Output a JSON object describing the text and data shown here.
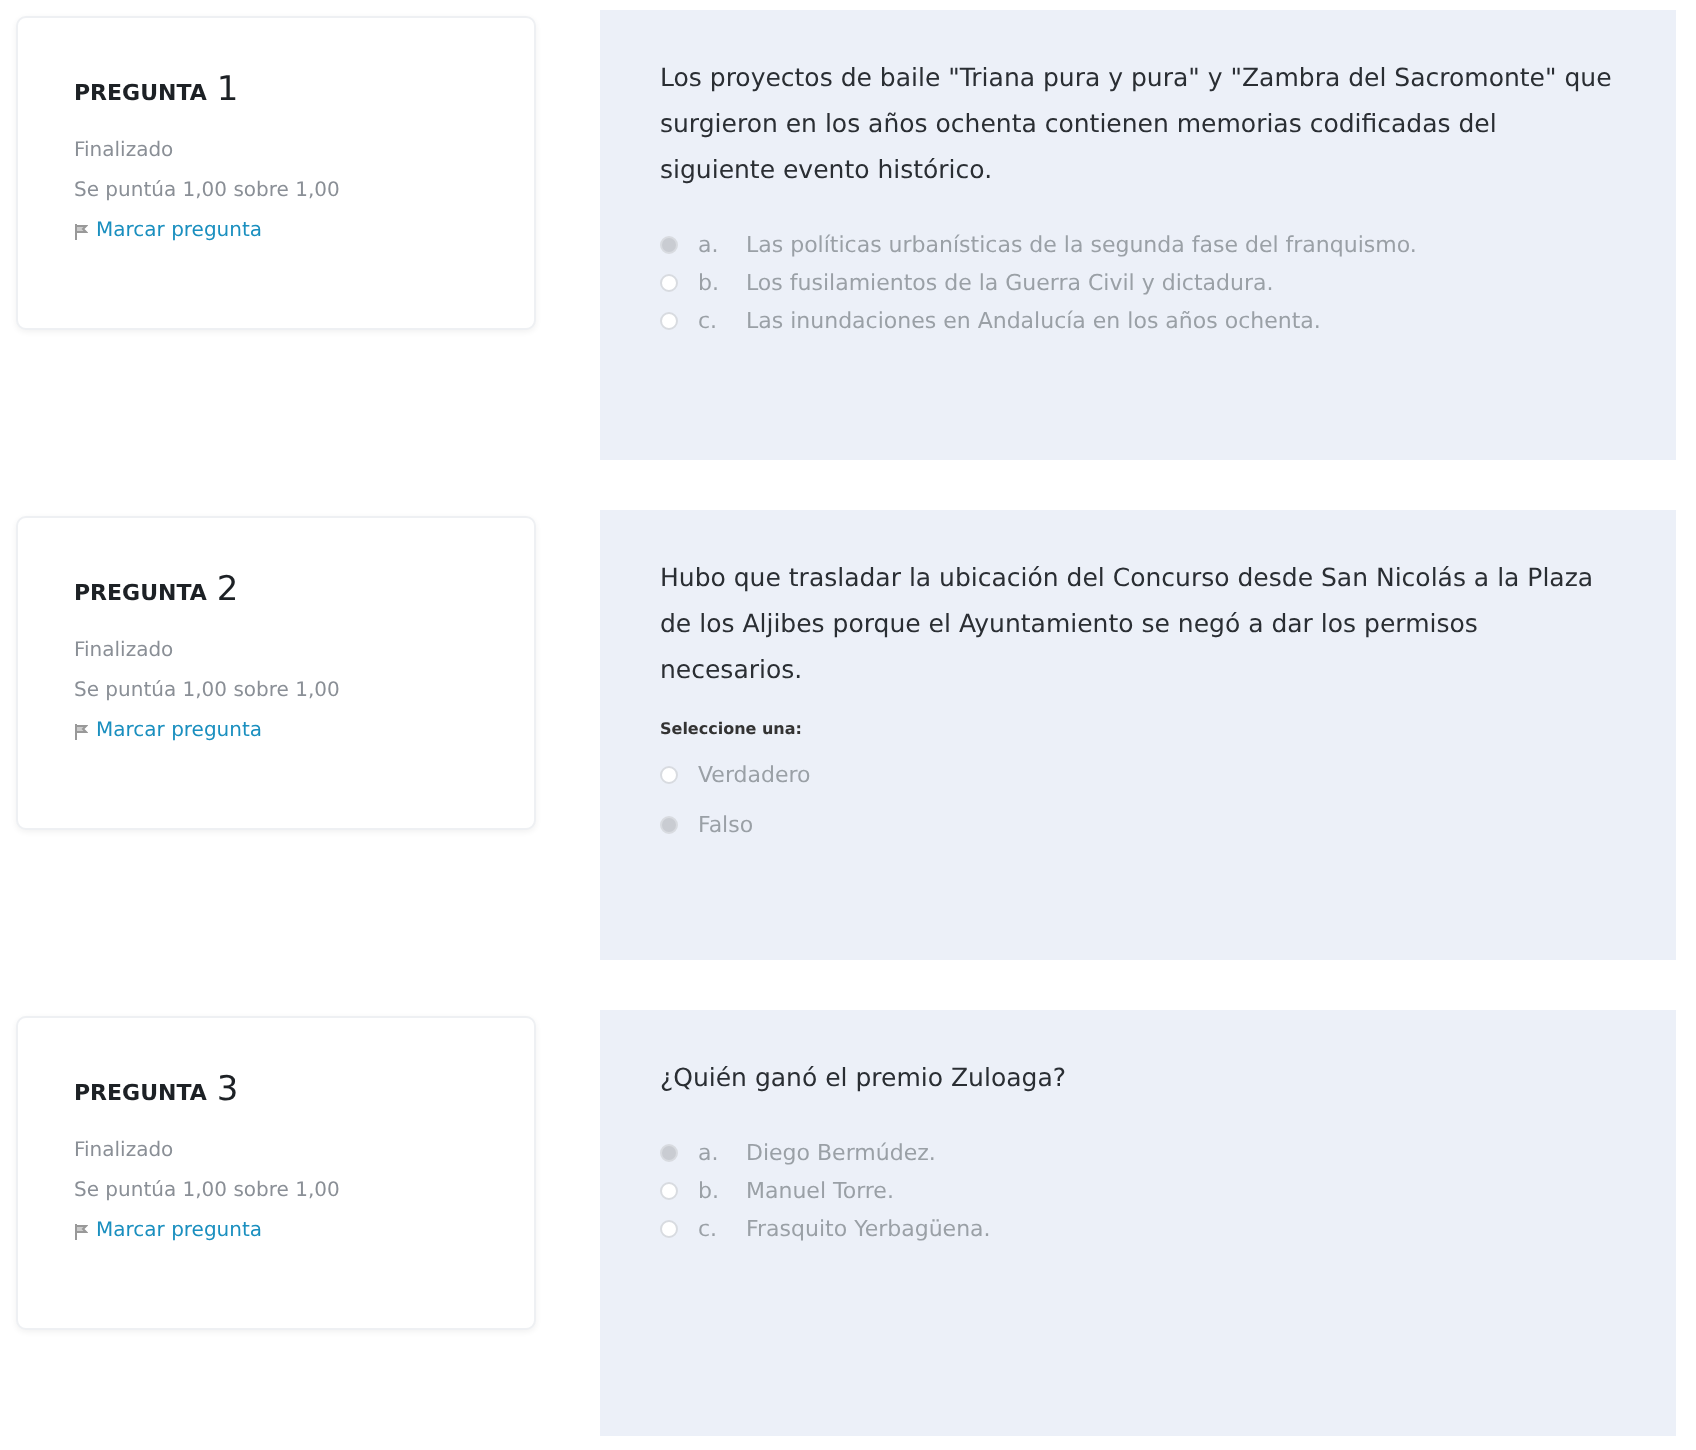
{
  "questions": [
    {
      "label": "PREGUNTA",
      "number": "1",
      "status": "Finalizado",
      "score": "Se puntúa 1,00 sobre 1,00",
      "flag_link": "Marcar pregunta",
      "text": "Los proyectos de baile \"Triana pura y pura\" y \"Zambra del Sacromonte\" que surgieron en los años ochenta contienen memorias codificadas del siguiente evento histórico.",
      "options": [
        {
          "letter": "a.",
          "text": "Las políticas urbanísticas de la segunda fase del franquismo.",
          "selected": true
        },
        {
          "letter": "b.",
          "text": "Los fusilamientos de la Guerra Civil y dictadura.",
          "selected": false
        },
        {
          "letter": "c.",
          "text": "Las inundaciones en Andalucía en los años ochenta.",
          "selected": false
        }
      ]
    },
    {
      "label": "PREGUNTA",
      "number": "2",
      "status": "Finalizado",
      "score": "Se puntúa 1,00 sobre 1,00",
      "flag_link": "Marcar pregunta",
      "text": "Hubo que trasladar la ubicación del Concurso desde San Nicolás a la Plaza de los Aljibes porque el Ayuntamiento se negó a dar los permisos necesarios.",
      "prompt": "Seleccione una:",
      "options": [
        {
          "text": "Verdadero",
          "selected": false
        },
        {
          "text": "Falso",
          "selected": true
        }
      ]
    },
    {
      "label": "PREGUNTA",
      "number": "3",
      "status": "Finalizado",
      "score": "Se puntúa 1,00 sobre 1,00",
      "flag_link": "Marcar pregunta",
      "text": "¿Quién ganó el premio Zuloaga?",
      "options": [
        {
          "letter": "a.",
          "text": "Diego Bermúdez.",
          "selected": true
        },
        {
          "letter": "b.",
          "text": "Manuel Torre.",
          "selected": false
        },
        {
          "letter": "c.",
          "text": "Frasquito Yerbagüena.",
          "selected": false
        }
      ]
    }
  ]
}
